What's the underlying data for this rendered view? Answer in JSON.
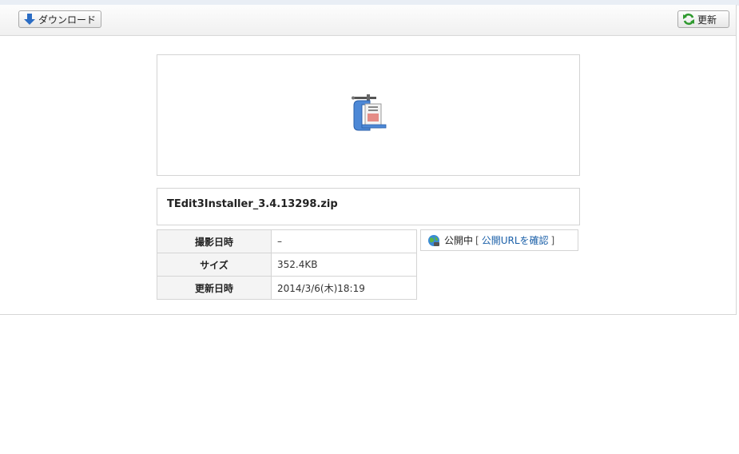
{
  "toolbar": {
    "download_label": "ダウンロード",
    "refresh_label": "更新"
  },
  "file": {
    "name": "TEdit3Installer_3.4.13298.zip",
    "icon": "zip-archive-icon"
  },
  "meta": {
    "rows": [
      {
        "label": "撮影日時",
        "value": "–"
      },
      {
        "label": "サイズ",
        "value": "352.4KB"
      },
      {
        "label": "更新日時",
        "value": "2014/3/6(木)18:19"
      }
    ]
  },
  "publish": {
    "status": "公開中",
    "open_bracket": "[",
    "link_label": "公開URLを確認",
    "close_bracket": "]"
  }
}
